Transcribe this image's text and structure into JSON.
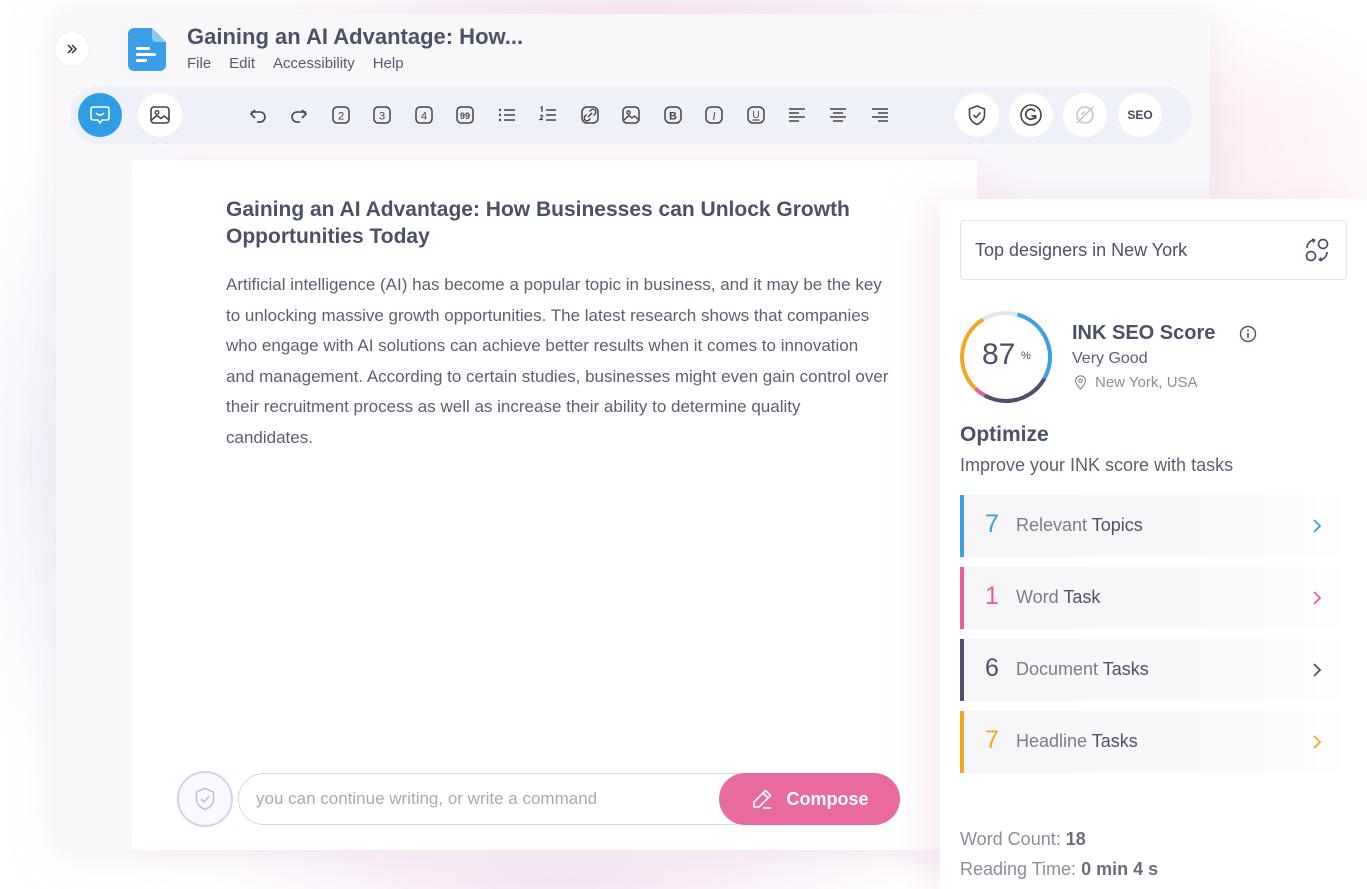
{
  "app": {
    "document_title": "Gaining an AI Advantage: How...",
    "menu": [
      "File",
      "Edit",
      "Accessibility",
      "Help"
    ]
  },
  "toolbar": {
    "left_buttons": [
      "chat-bubble-icon",
      "image-icon"
    ],
    "format_buttons": [
      "undo-icon",
      "redo-icon",
      "heading-2-icon",
      "heading-3-icon",
      "heading-4-icon",
      "quote-icon",
      "bullet-list-icon",
      "numbered-list-icon",
      "link-icon",
      "insert-image-icon",
      "bold-icon",
      "italic-icon",
      "underline-icon",
      "align-left-icon",
      "align-center-icon",
      "align-right-icon"
    ],
    "heading_labels": [
      "2",
      "3",
      "4"
    ],
    "quote_label": "99",
    "bold_label": "B",
    "italic_label": "I",
    "underline_label": "U",
    "right_buttons": [
      "shield-check-icon",
      "grammarly-icon",
      "hide-icon"
    ],
    "seo_label": "SEO"
  },
  "article": {
    "title": "Gaining an AI Advantage: How Businesses can Unlock Growth Opportunities Today",
    "body": "Artificial intelligence (AI) has become a popular topic in business, and it may be the key to unlocking massive growth opportunities. The latest research shows that companies who engage with AI solutions can achieve better results when it comes to innovation and management. According to certain studies, businesses might even gain control over their recruitment process as well as increase their ability to determine quality candidates."
  },
  "compose": {
    "placeholder": "you can continue writing, or write a command",
    "button_label": "Compose"
  },
  "panel": {
    "search_value": "Top designers in New York",
    "score": {
      "value": "87",
      "unit": "%",
      "title": "INK SEO Score",
      "grade": "Very Good",
      "location": "New York, USA"
    },
    "optimize": {
      "title": "Optimize",
      "subtitle": "Improve your INK score with tasks"
    },
    "tasks": [
      {
        "count": "7",
        "label_prefix": "Relevant ",
        "label_main": "Topics",
        "color": "#3aa0e0"
      },
      {
        "count": "1",
        "label_prefix": "Word ",
        "label_main": "Task",
        "color": "#e5609a"
      },
      {
        "count": "6",
        "label_prefix": "Document ",
        "label_main": "Tasks",
        "color": "#4b5168"
      },
      {
        "count": "7",
        "label_prefix": "Headline ",
        "label_main": "Tasks",
        "color": "#f0a81e"
      }
    ],
    "stats": {
      "word_count_label": "Word Count: ",
      "word_count": "18",
      "reading_time_label": "Reading Time: ",
      "reading_time": "0 min 4 s"
    }
  },
  "colors": {
    "primary_blue": "#2f9de4",
    "compose_pink": "#e86a9e",
    "text_dark": "#4b5168"
  }
}
